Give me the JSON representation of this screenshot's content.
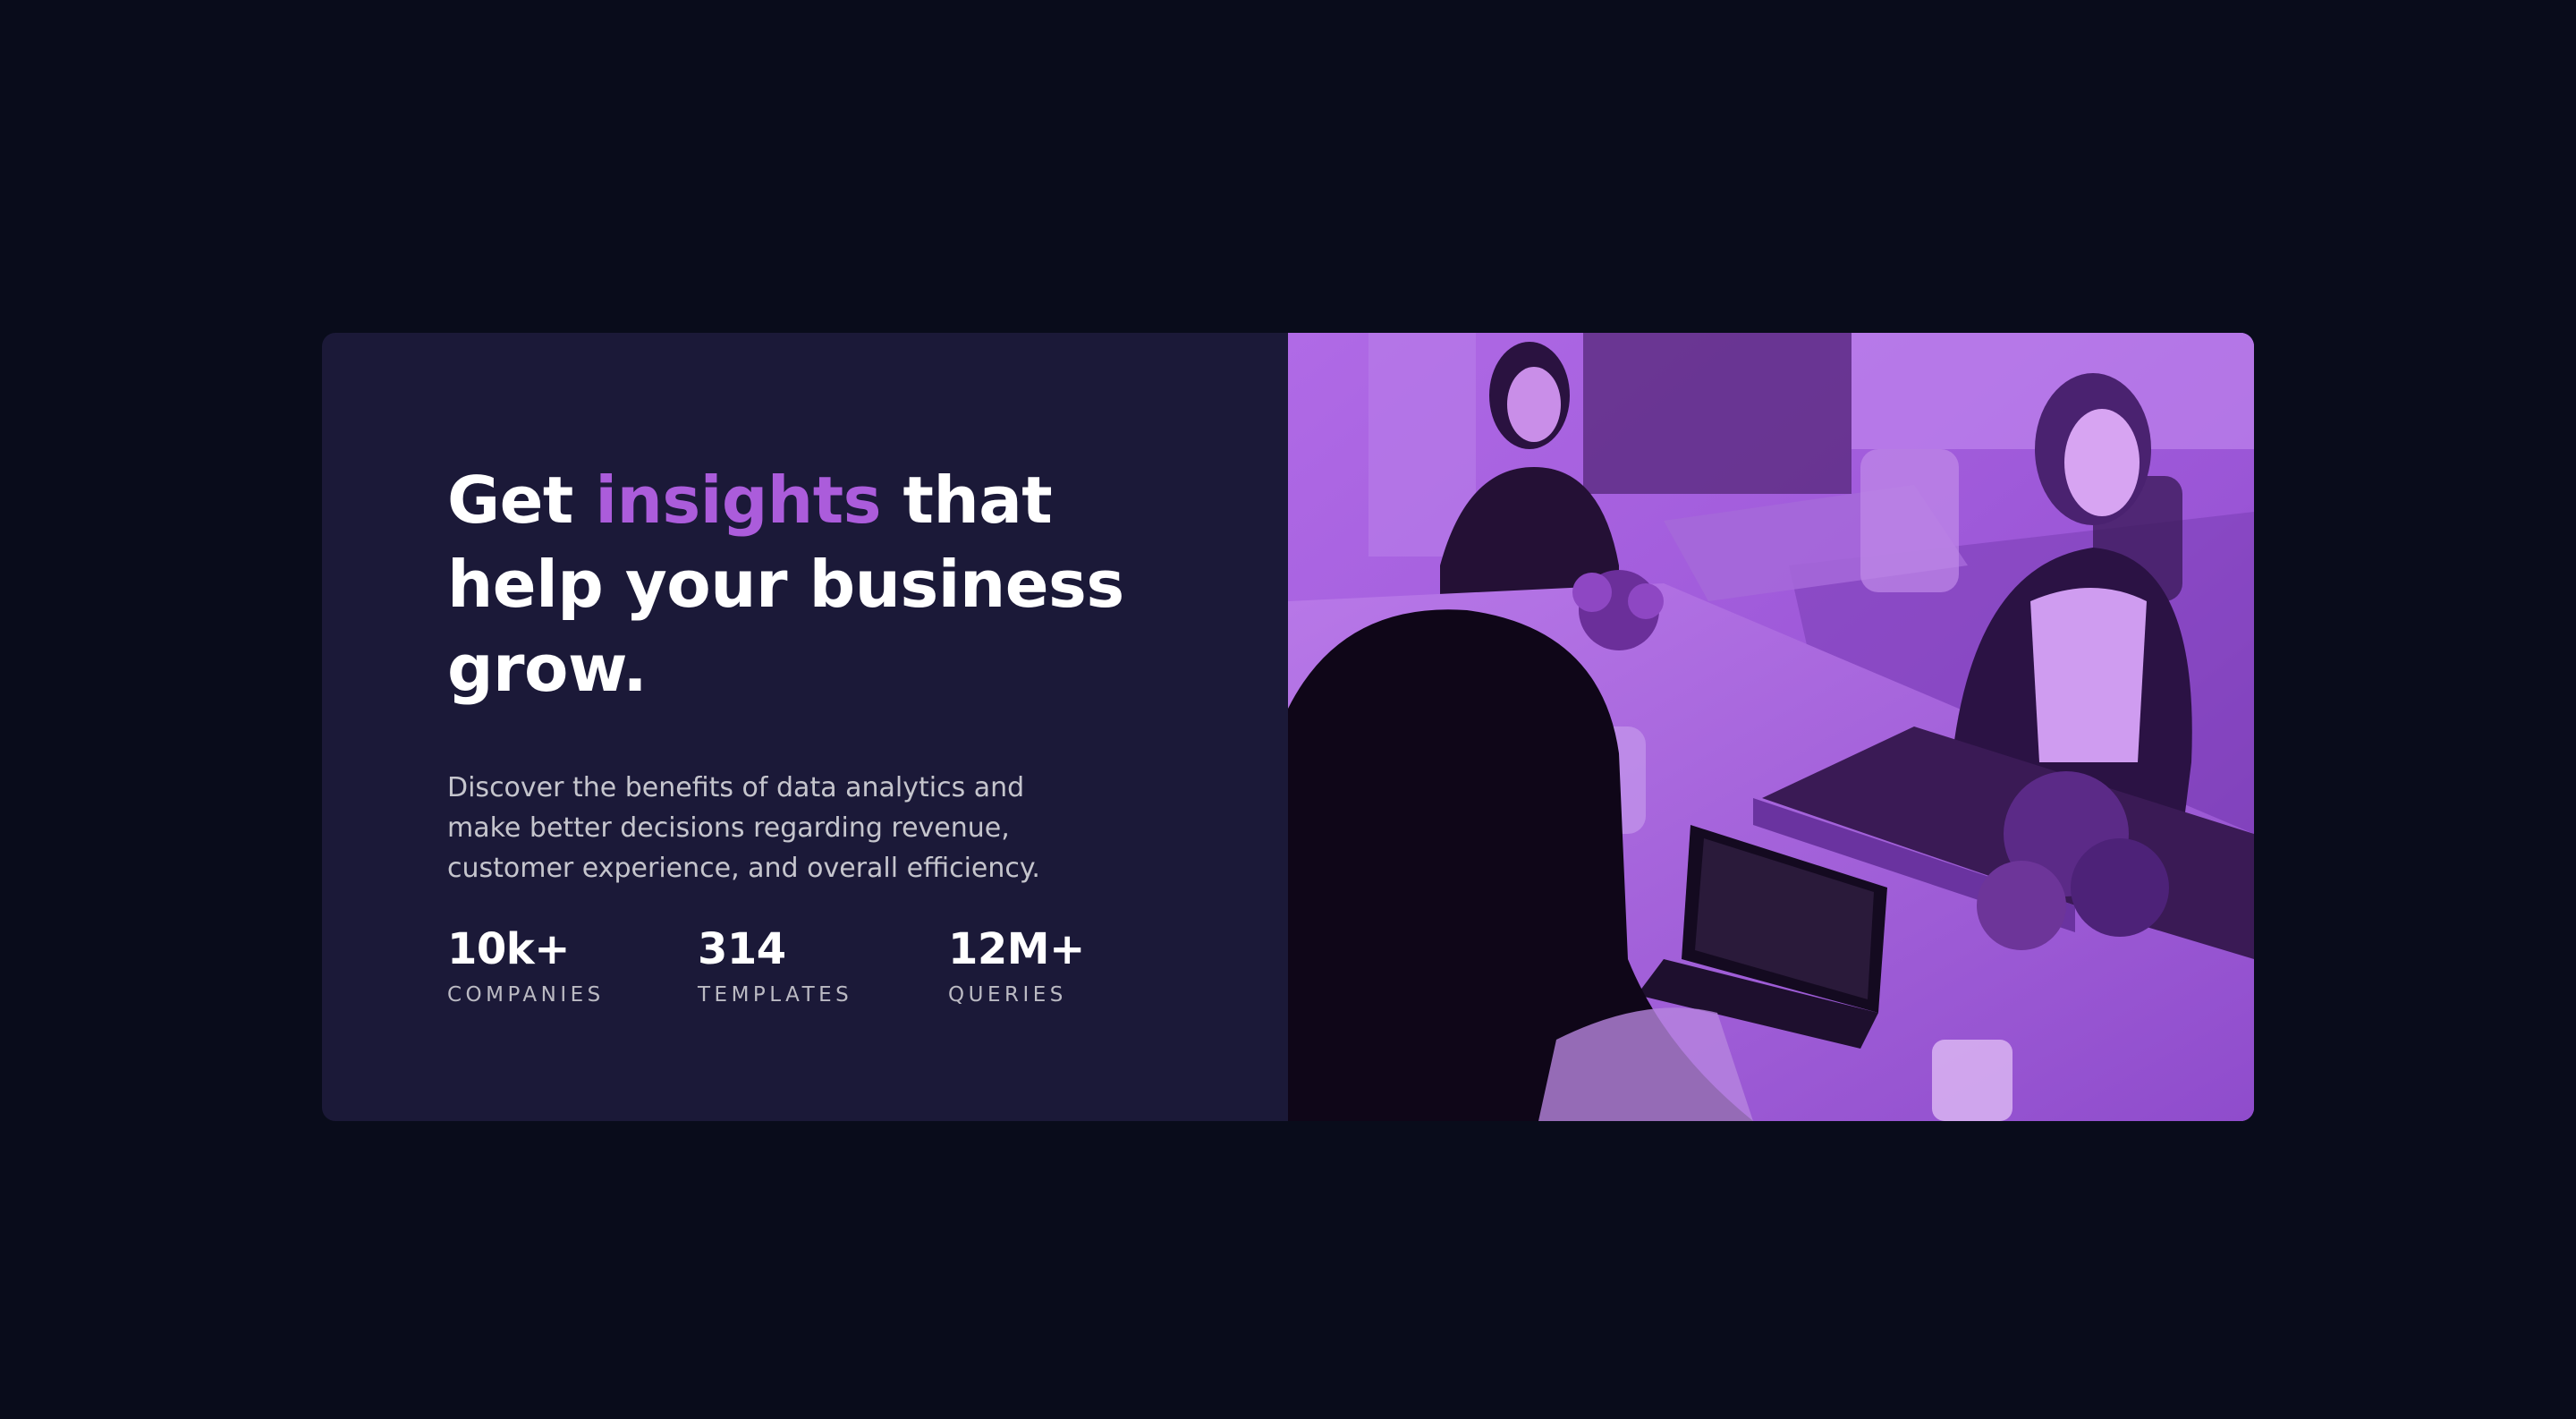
{
  "hero": {
    "headline_part1": "Get ",
    "headline_accent": "insights",
    "headline_part2": " that help your business grow.",
    "description": "Discover the benefits of data analytics and make better decisions regarding revenue, customer experience, and overall efficiency."
  },
  "stats": [
    {
      "value": "10k+",
      "label": "COMPANIES"
    },
    {
      "value": "314",
      "label": "TEMPLATES"
    },
    {
      "value": "12M+",
      "label": "QUERIES"
    }
  ],
  "image": {
    "alt": "Three women working at a table with laptops"
  },
  "colors": {
    "page_background": "#090c1b",
    "card_background": "#1b1938",
    "accent": "#ab5cdb",
    "image_overlay": "#a45fe0"
  }
}
